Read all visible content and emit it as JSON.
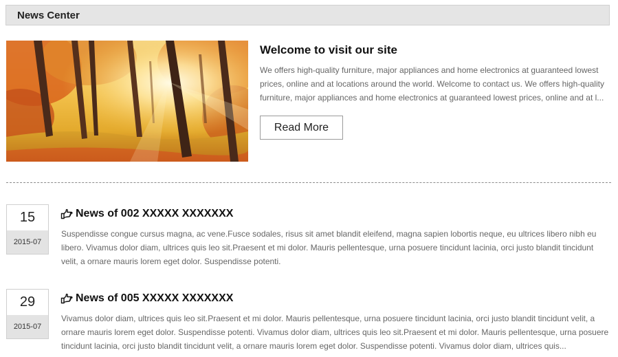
{
  "header": {
    "title": "News Center"
  },
  "featured": {
    "image_alt": "autumn forest",
    "title": "Welcome to visit our site",
    "description": "We offers high-quality furniture, major appliances and home electronics at guaranteed lowest prices, online and at locations around the world. Welcome to contact us. We offers high-quality furniture, major appliances and home electronics at guaranteed lowest prices, online and at l...",
    "read_more_label": "Read More"
  },
  "news": [
    {
      "day": "15",
      "month": "2015-07",
      "title": "News of 002 XXXXX XXXXXXX",
      "description": "Suspendisse congue cursus magna, ac vene.Fusce sodales, risus sit amet blandit eleifend, magna sapien lobortis neque, eu ultrices libero nibh eu libero. Vivamus dolor diam, ultrices quis leo sit.Praesent et mi dolor. Mauris pellentesque, urna posuere tincidunt lacinia, orci justo blandit tincidunt velit, a ornare mauris lorem eget dolor. Suspendisse potenti."
    },
    {
      "day": "29",
      "month": "2015-07",
      "title": "News of 005 XXXXX XXXXXXX",
      "description": "Vivamus dolor diam, ultrices quis leo sit.Praesent et mi dolor. Mauris pellentesque, urna posuere tincidunt lacinia, orci justo blandit tincidunt velit, a ornare mauris lorem eget dolor. Suspendisse potenti. Vivamus dolor diam, ultrices quis leo sit.Praesent et mi dolor. Mauris pellentesque, urna posuere tincidunt lacinia, orci justo blandit tincidunt velit, a ornare mauris lorem eget dolor. Suspendisse potenti. Vivamus dolor diam, ultrices quis..."
    }
  ],
  "icons": {
    "news_title_icon": "pointing-hand-icon"
  },
  "colors": {
    "header_bg": "#e5e5e5",
    "date_month_bg": "#e3e3e3",
    "text_muted": "#666666"
  }
}
